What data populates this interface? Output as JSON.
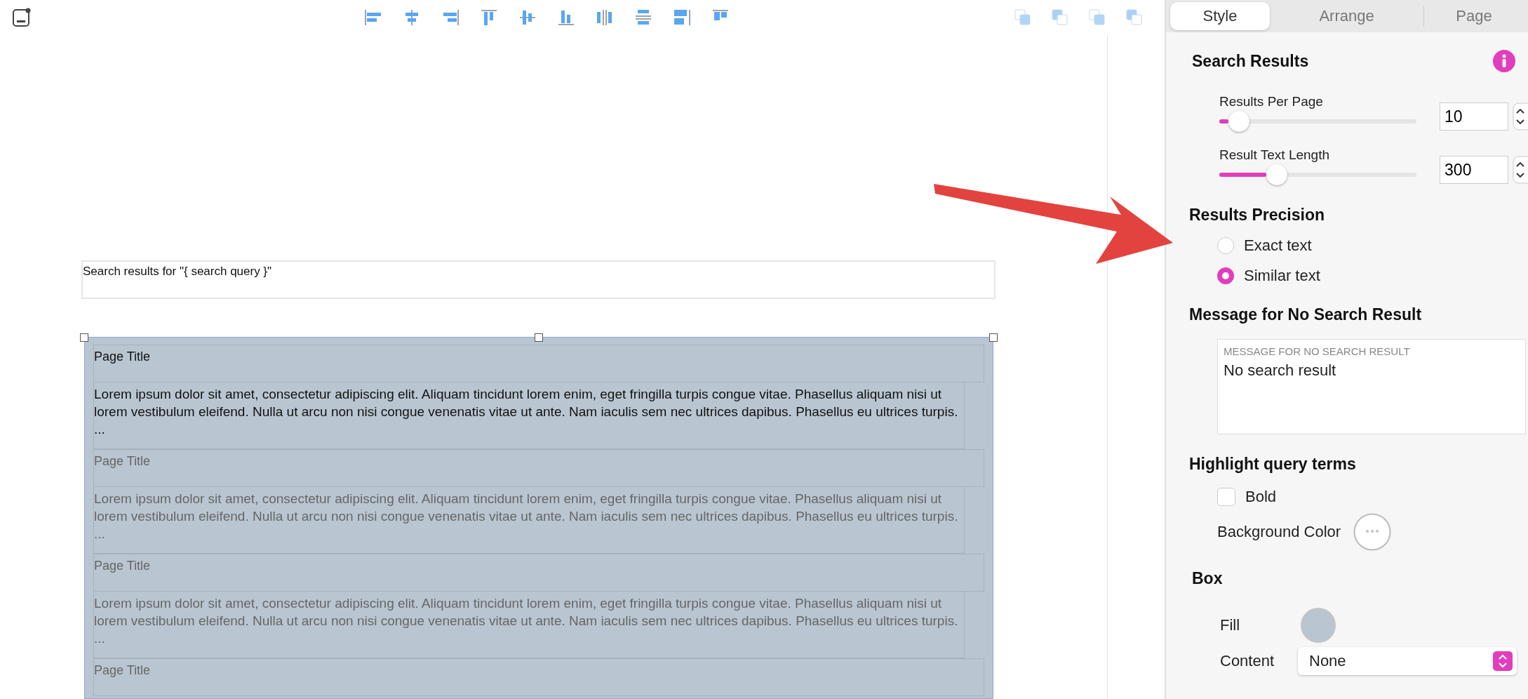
{
  "canvas": {
    "search_heading": "Search results for \"{ search query }\"",
    "results": [
      {
        "title": "Page Title",
        "excerpt": "Lorem ipsum dolor sit amet, consectetur adipiscing elit. Aliquam tincidunt lorem enim, eget fringilla turpis congue vitae. Phasellus aliquam nisi ut lorem vestibulum eleifend. Nulla ut arcu non nisi congue venenatis vitae ut ante. Nam iaculis sem nec ultrices dapibus. Phasellus eu ultrices turpis. ...",
        "dimmed": false
      },
      {
        "title": "Page Title",
        "excerpt": "Lorem ipsum dolor sit amet, consectetur adipiscing elit. Aliquam tincidunt lorem enim, eget fringilla turpis congue vitae. Phasellus aliquam nisi ut lorem vestibulum eleifend. Nulla ut arcu non nisi congue venenatis vitae ut ante. Nam iaculis sem nec ultrices dapibus. Phasellus eu ultrices turpis. ...",
        "dimmed": true
      },
      {
        "title": "Page Title",
        "excerpt": "Lorem ipsum dolor sit amet, consectetur adipiscing elit. Aliquam tincidunt lorem enim, eget fringilla turpis congue vitae. Phasellus aliquam nisi ut lorem vestibulum eleifend. Nulla ut arcu non nisi congue venenatis vitae ut ante. Nam iaculis sem nec ultrices dapibus. Phasellus eu ultrices turpis. ...",
        "dimmed": true
      },
      {
        "title": "Page Title",
        "dimmed": true
      }
    ]
  },
  "inspector": {
    "tabs": [
      {
        "label": "Style",
        "selected": true
      },
      {
        "label": "Arrange",
        "selected": false
      },
      {
        "label": "Page",
        "selected": false
      }
    ],
    "search_results": {
      "heading": "Search Results",
      "sliders": [
        {
          "label": "Results Per Page",
          "level": 0.1,
          "value": "10"
        },
        {
          "label": "Result Text Length",
          "level": 0.29,
          "value": "300"
        }
      ]
    },
    "precision": {
      "heading": "Results Precision",
      "options": [
        {
          "label": "Exact text",
          "selected": false
        },
        {
          "label": "Similar text",
          "selected": true
        }
      ]
    },
    "no_result": {
      "heading": "Message for No Search Result",
      "field_label": "MESSAGE FOR NO SEARCH RESULT",
      "value": "No search result"
    },
    "highlight": {
      "heading": "Highlight query terms",
      "bold": {
        "label": "Bold",
        "checked": false
      },
      "background_label": "Background Color"
    },
    "box": {
      "heading": "Box",
      "fill": {
        "label": "Fill",
        "color": "#b9c6d1"
      },
      "content": {
        "label": "Content",
        "value": "None"
      }
    }
  }
}
